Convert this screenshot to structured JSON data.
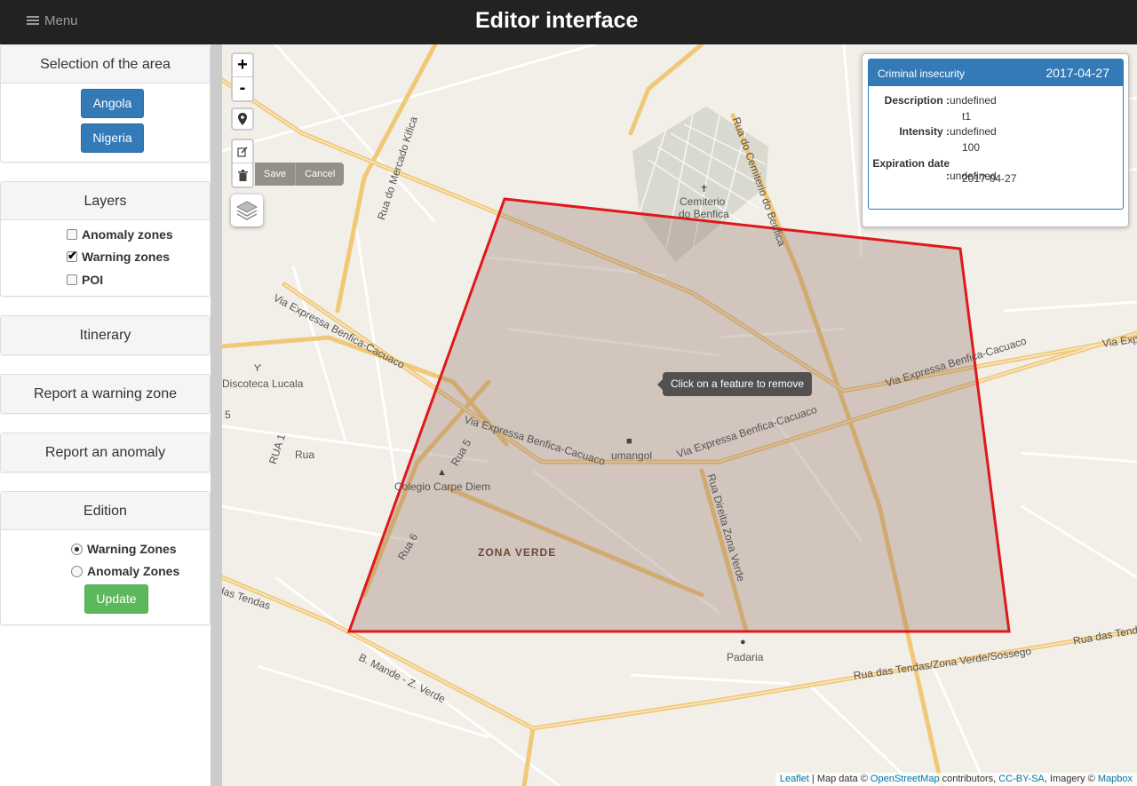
{
  "header": {
    "menu_label": "Menu",
    "title": "Editor interface"
  },
  "sidebar": {
    "area": {
      "title": "Selection of the area",
      "buttons": [
        "Angola",
        "Nigeria"
      ]
    },
    "layers": {
      "title": "Layers",
      "items": [
        {
          "label": "Anomaly zones",
          "checked": false
        },
        {
          "label": "Warning zones",
          "checked": true
        },
        {
          "label": "POI",
          "checked": false
        }
      ]
    },
    "itinerary": "Itinerary",
    "report_warning": "Report a warning zone",
    "report_anomaly": "Report an anomaly",
    "edition": {
      "title": "Edition",
      "options": [
        {
          "label": "Warning Zones",
          "selected": true
        },
        {
          "label": "Anomaly Zones",
          "selected": false
        }
      ],
      "update_label": "Update"
    }
  },
  "map": {
    "controls": {
      "zoom_in": "+",
      "zoom_out": "-",
      "save": "Save",
      "cancel": "Cancel"
    },
    "tooltip": "Click on a feature to remove",
    "zone_color": "#e0181b",
    "labels": {
      "cemetery_1": "Cemiterio",
      "cemetery_2": "do Benfica",
      "discoteca": "Discoteca Lucala",
      "colegio": "Colegio Carpe Diem",
      "zona_verde": "ZONA VERDE",
      "padaria": "Padaria",
      "sumangol": "umangol",
      "via_expressa_1": "Via Expressa Benfica-Cacuaco",
      "via_expressa_2": "Via Expressa Benfica-Cacuaco",
      "via_expressa_3": "Via Expressa Benfica-Cacuaco",
      "via_expressa_4": "Via Expressa Benfica-Cacuaco",
      "via_expressa_5": "Via Expr",
      "rua_mercado": "Rua do Mercado Kifica",
      "rua_cemiterio": "Rua do Cemiterio do Benfica",
      "rua_direita": "Rua Direita Zona Verde",
      "rua_tendas": "Rua das Tendas/Zona Verde/Sossego",
      "rua_tendas_2": "Rua das Tendas",
      "das_tendas": "das Tendas",
      "b_mande": "B. Mande - Z. Verde",
      "rua_1": "RUA 1",
      "rua": "Rua",
      "rua_5": "Rua 5",
      "rua_6": "Rua 6",
      "five": "5"
    },
    "attribution": {
      "leaflet": "Leaflet",
      "map_data": " | Map data © ",
      "osm": "OpenStreetMap",
      "contributors": " contributors, ",
      "ccbysa": "CC-BY-SA",
      "imagery": ", Imagery © ",
      "mapbox": "Mapbox"
    }
  },
  "info_popup": {
    "title": "Criminal insecurity",
    "date": "2017-04-27",
    "rows": [
      {
        "label": "Description :",
        "value1": "undefined",
        "value2": "t1"
      },
      {
        "label": "Intensity :",
        "value1": "undefined",
        "value2": "100"
      },
      {
        "label": "Expiration date :",
        "value1": "undefined",
        "value2": "2017-04-27"
      }
    ]
  }
}
